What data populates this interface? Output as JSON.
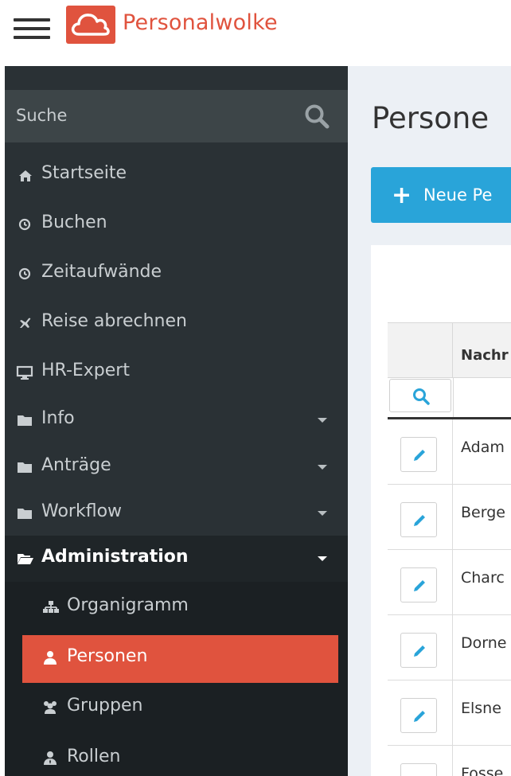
{
  "header": {
    "logo_text": "Personalwolke"
  },
  "sidebar": {
    "search_placeholder": "Suche",
    "items": [
      {
        "label": "Startseite",
        "icon": "home-icon"
      },
      {
        "label": "Buchen",
        "icon": "clock-icon"
      },
      {
        "label": "Zeitaufwände",
        "icon": "clock-icon"
      },
      {
        "label": "Reise abrechnen",
        "icon": "plane-icon"
      },
      {
        "label": "HR-Expert",
        "icon": "monitor-icon"
      },
      {
        "label": "Info",
        "icon": "folder-icon",
        "expandable": true
      },
      {
        "label": "Anträge",
        "icon": "folder-icon",
        "expandable": true
      },
      {
        "label": "Workflow",
        "icon": "folder-icon",
        "expandable": true
      },
      {
        "label": "Administration",
        "icon": "folder-open-icon",
        "expandable": true,
        "expanded": true
      }
    ],
    "subitems": [
      {
        "label": "Organigramm",
        "icon": "sitemap-icon"
      },
      {
        "label": "Personen",
        "icon": "user-icon",
        "active": true
      },
      {
        "label": "Gruppen",
        "icon": "users-icon"
      },
      {
        "label": "Rollen",
        "icon": "user-tie-icon"
      }
    ]
  },
  "main": {
    "title": "Persone",
    "new_button_label": "Neue Pe",
    "table": {
      "column_header": "Nachr",
      "rows": [
        "Adam",
        "Berge",
        "Charc",
        "Dorne",
        "Elsne",
        "Fosse"
      ]
    }
  },
  "colors": {
    "brand": "#e0533e",
    "sidebar_bg": "#2a3135",
    "accent_blue": "#29a4d9",
    "content_bg": "#ecf0f5"
  }
}
